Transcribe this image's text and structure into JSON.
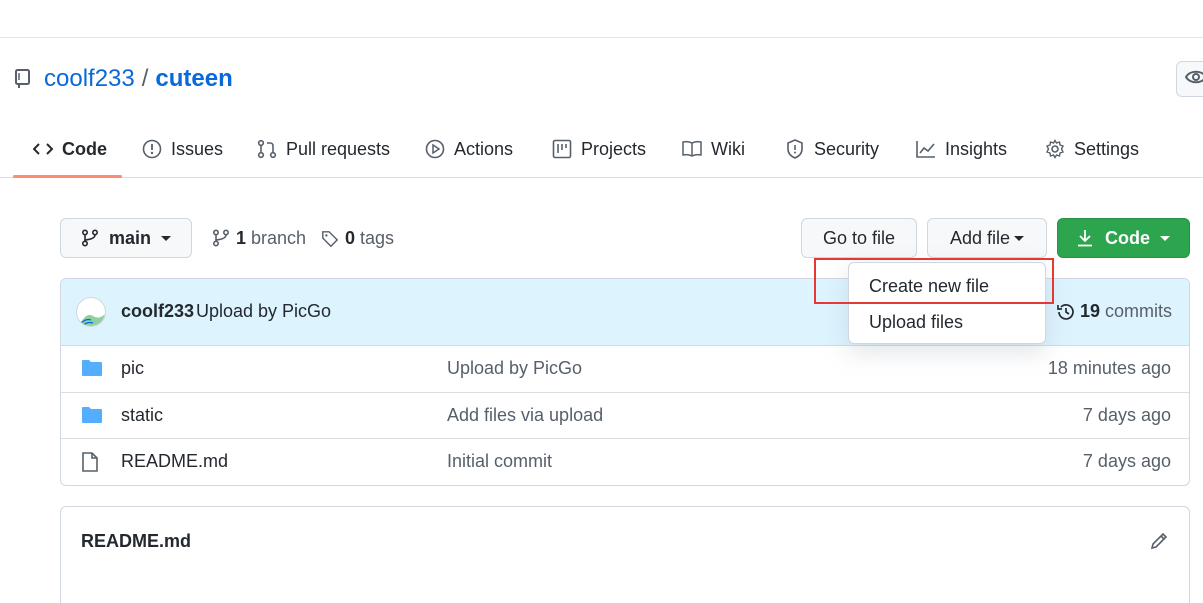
{
  "repo": {
    "owner": "coolf233",
    "separator": "/",
    "name": "cuteen"
  },
  "tabs": [
    {
      "label": "Code",
      "icon": "code-icon"
    },
    {
      "label": "Issues",
      "icon": "issue-icon"
    },
    {
      "label": "Pull requests",
      "icon": "pull-request-icon"
    },
    {
      "label": "Actions",
      "icon": "play-icon"
    },
    {
      "label": "Projects",
      "icon": "project-icon"
    },
    {
      "label": "Wiki",
      "icon": "book-icon"
    },
    {
      "label": "Security",
      "icon": "shield-icon"
    },
    {
      "label": "Insights",
      "icon": "graph-icon"
    },
    {
      "label": "Settings",
      "icon": "gear-icon"
    }
  ],
  "toolbar": {
    "branch": "main",
    "branch_count": "1",
    "branch_label": "branch",
    "tag_count": "0",
    "tag_label": "tags",
    "go_to_file": "Go to file",
    "add_file": "Add file",
    "code": "Code"
  },
  "add_file_menu": {
    "items": [
      "Create new file",
      "Upload files"
    ]
  },
  "commit": {
    "author": "coolf233",
    "message": "Upload by PicGo",
    "count": "19",
    "count_label": "commits"
  },
  "files": [
    {
      "name": "pic",
      "type": "folder",
      "message": "Upload by PicGo",
      "age": "18 minutes ago"
    },
    {
      "name": "static",
      "type": "folder",
      "message": "Add files via upload",
      "age": "7 days ago"
    },
    {
      "name": "README.md",
      "type": "file",
      "message": "Initial commit",
      "age": "7 days ago"
    }
  ],
  "readme": {
    "title": "README.md"
  },
  "colors": {
    "accent_link": "#0969da",
    "primary_button": "#2da44e",
    "tab_underline": "#fd8c73",
    "commit_bar": "#ddf4ff",
    "highlight_box": "#e53935",
    "folder": "#54aeff"
  }
}
